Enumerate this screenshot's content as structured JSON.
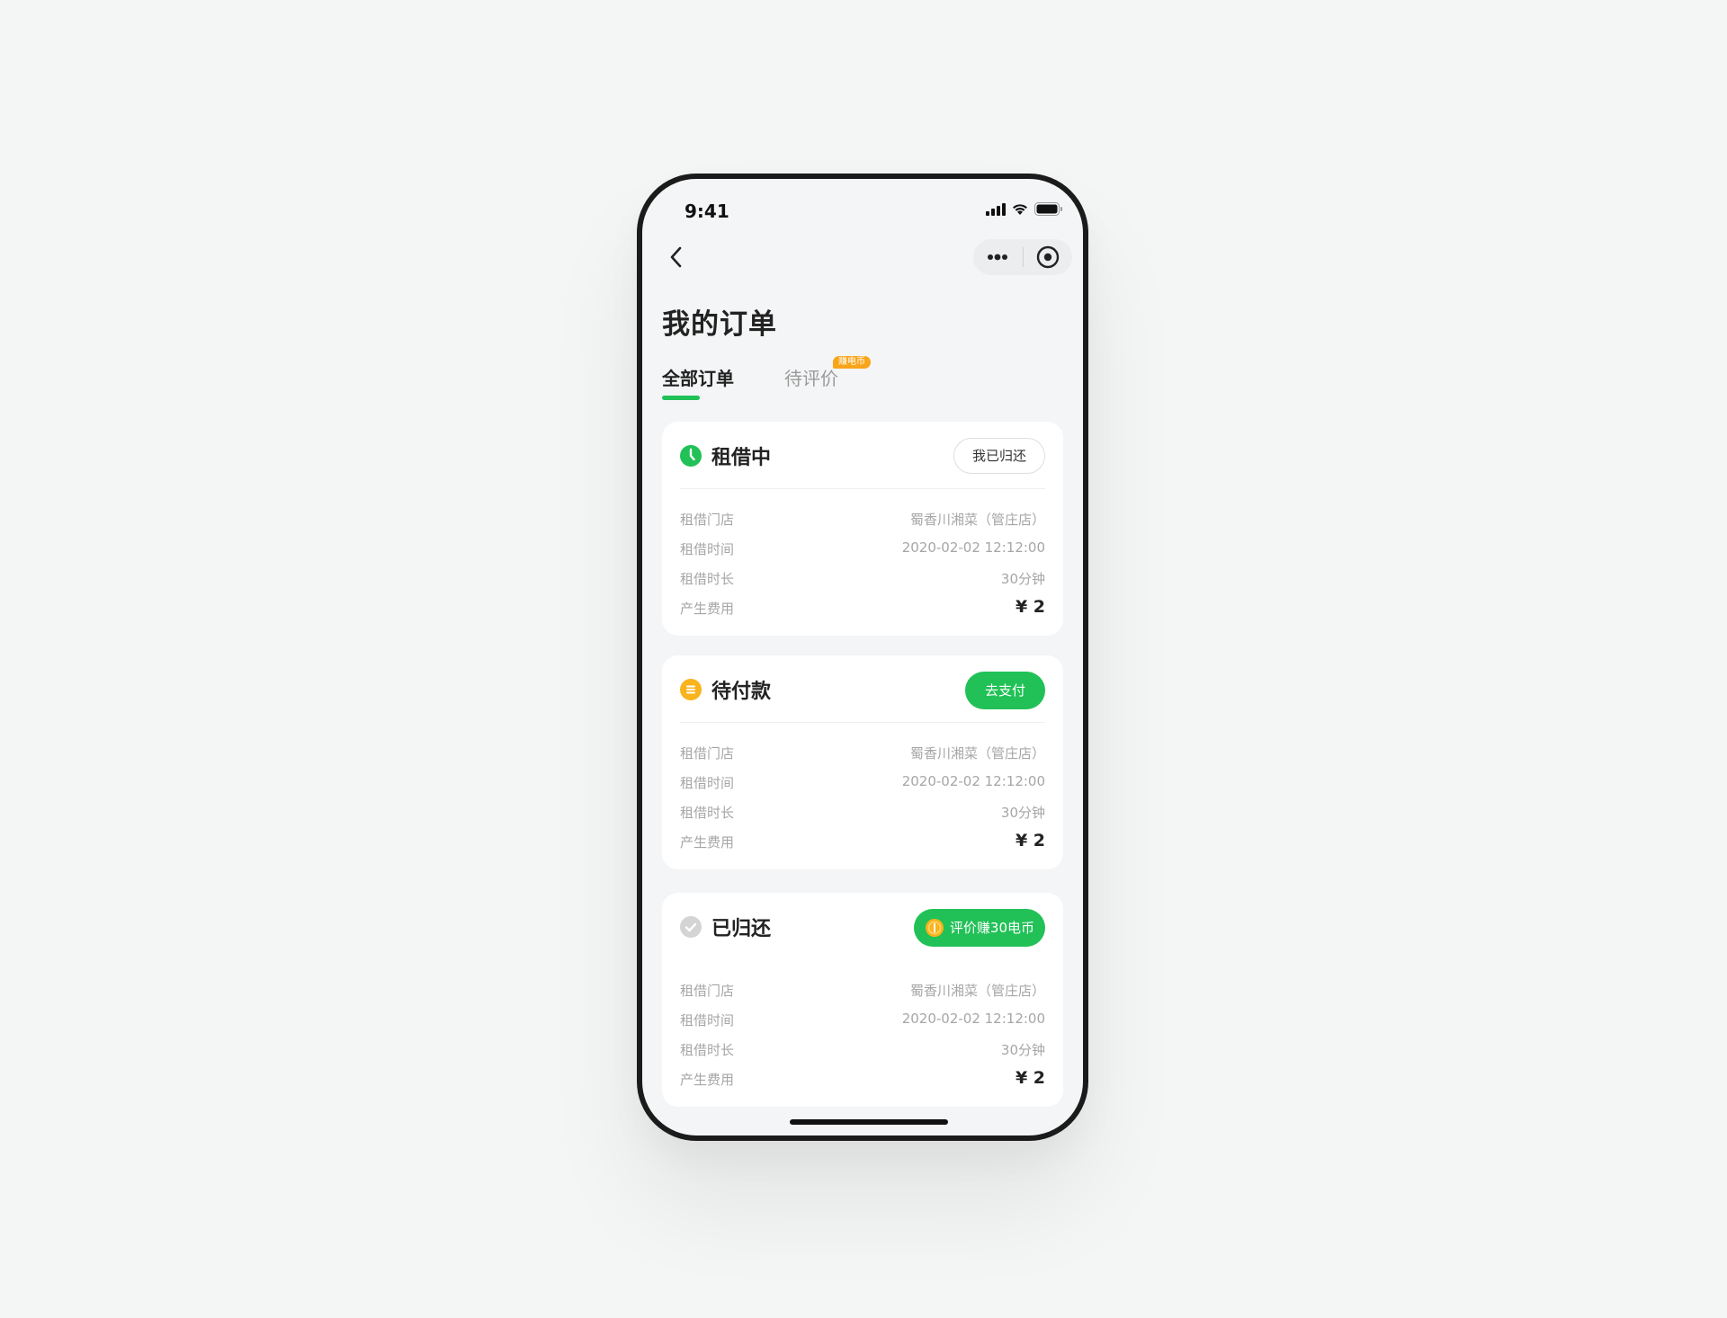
{
  "status_bar": {
    "time": "9:41"
  },
  "page": {
    "title": "我的订单"
  },
  "tabs": [
    {
      "label": "全部订单"
    },
    {
      "label": "待评价",
      "badge": "赚电币"
    }
  ],
  "orders": [
    {
      "status": "租借中",
      "action": "我已归还",
      "rows": [
        {
          "key": "租借门店",
          "value": "蜀香川湘菜（管庄店）"
        },
        {
          "key": "租借时间",
          "value": "2020-02-02 12:12:00"
        },
        {
          "key": "租借时长",
          "value": "30分钟"
        },
        {
          "key": "产生费用",
          "value": "¥ 2"
        }
      ]
    },
    {
      "status": "待付款",
      "action": "去支付",
      "rows": [
        {
          "key": "租借门店",
          "value": "蜀香川湘菜（管庄店）"
        },
        {
          "key": "租借时间",
          "value": "2020-02-02 12:12:00"
        },
        {
          "key": "租借时长",
          "value": "30分钟"
        },
        {
          "key": "产生费用",
          "value": "¥ 2"
        }
      ]
    },
    {
      "status": "已归还",
      "action": "评价赚30电币",
      "rows": [
        {
          "key": "租借门店",
          "value": "蜀香川湘菜（管庄店）"
        },
        {
          "key": "租借时间",
          "value": "2020-02-02 12:12:00"
        },
        {
          "key": "租借时长",
          "value": "30分钟"
        },
        {
          "key": "产生费用",
          "value": "¥ 2"
        }
      ]
    }
  ],
  "colors": {
    "accent_green": "#21c157",
    "pending_yellow": "#f9b31c",
    "badge_orange": "#f9a51a",
    "returned_gray": "#d4d4d4"
  },
  "icons": {
    "back": "chevron-left-icon",
    "more": "more-dots-icon",
    "close": "target-circle-icon",
    "renting": "clock-icon",
    "pending": "coin-list-icon",
    "returned": "check-circle-icon",
    "reward": "coin-icon"
  }
}
